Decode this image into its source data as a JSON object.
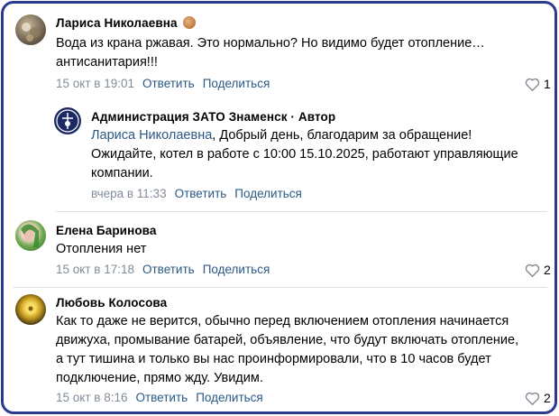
{
  "comments": [
    {
      "author": "Лариса Николаевна",
      "lines": [
        "Вода из крана ржавая. Это нормально? Но видимо будет отопление…",
        "антисанитария!!!"
      ],
      "time": "15 окт в 19:01",
      "reply_label": "Ответить",
      "share_label": "Поделиться",
      "likes": "1"
    },
    {
      "author": "Администрация ЗАТО Знаменск · Автор",
      "mention": "Лариса Николаевна",
      "line1_rest": ", Добрый день, благодарим за обращение!",
      "lines": [
        "Ожидайте, котел в работе с 10:00 15.10.2025, работают управляющие",
        "компании."
      ],
      "time": "вчера в 11:33",
      "reply_label": "Ответить",
      "share_label": "Поделиться"
    },
    {
      "author": "Елена Баринова",
      "lines": [
        "Отопления нет"
      ],
      "time": "15 окт в 17:18",
      "reply_label": "Ответить",
      "share_label": "Поделиться",
      "likes": "2"
    },
    {
      "author": "Любовь Колосова",
      "lines": [
        "Как то даже не верится, обычно перед включением отопления начинается",
        "движуха, промывание батарей, объявление, что будут включать отопление,",
        "а тут тишина и только вы нас проинформировали, что в 10 часов будет",
        "подключение, прямо жду. Увидим."
      ],
      "time": "15 окт в 8:16",
      "reply_label": "Ответить",
      "share_label": "Поделиться",
      "likes": "2"
    }
  ],
  "icons": {
    "like": "heart-outline-icon"
  },
  "colors": {
    "frame": "#2b3a8f",
    "link": "#2a5885",
    "meta": "#818c99"
  }
}
